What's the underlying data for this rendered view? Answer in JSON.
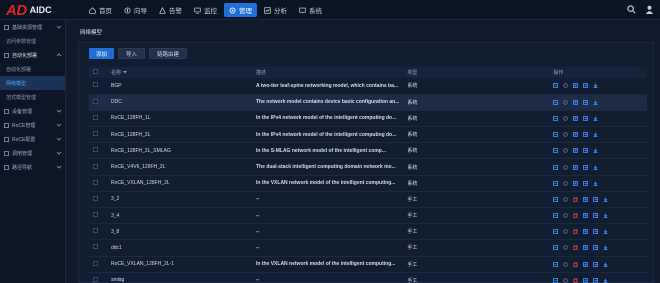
{
  "brand": {
    "mark": "AD",
    "name": "AIDC"
  },
  "nav": [
    {
      "label": "首页",
      "icon": "home-icon"
    },
    {
      "label": "向导",
      "icon": "guide-icon"
    },
    {
      "label": "告警",
      "icon": "alarm-icon"
    },
    {
      "label": "监控",
      "icon": "monitor-icon"
    },
    {
      "label": "管理",
      "icon": "manage-icon",
      "active": true
    },
    {
      "label": "分析",
      "icon": "analysis-icon"
    },
    {
      "label": "系统",
      "icon": "system-icon"
    }
  ],
  "sidebar": {
    "items": [
      {
        "label": "基础资源管理",
        "kind": "group"
      },
      {
        "label": "访问参数管理",
        "kind": "sub"
      },
      {
        "label": "自动化部署",
        "kind": "group-open"
      },
      {
        "label": "自动化部署",
        "kind": "sub"
      },
      {
        "label": "网络模型",
        "kind": "current"
      },
      {
        "label": "范式模型管理",
        "kind": "sub"
      },
      {
        "label": "设备管理",
        "kind": "group"
      },
      {
        "label": "RoCE管理",
        "kind": "group"
      },
      {
        "label": "RoCE配置",
        "kind": "group"
      },
      {
        "label": "调用管理",
        "kind": "group"
      },
      {
        "label": "路径导航",
        "kind": "group"
      }
    ]
  },
  "page": {
    "title": "网络模型"
  },
  "toolbar": {
    "add": "添加",
    "import": "导入",
    "lead": "链路由建"
  },
  "table": {
    "headers": {
      "name": "名称",
      "desc": "描述",
      "type": "类型",
      "ops": "操作"
    },
    "rows": [
      {
        "name": "BGP",
        "desc": "A two-tier leaf-spine networking model, which contains ba...",
        "type": "系统",
        "ops": 5
      },
      {
        "name": "DDC",
        "desc": "The network model contains device basic configuration an...",
        "type": "系统",
        "ops": 5,
        "selected": true
      },
      {
        "name": "RoCE_128FH_1L",
        "desc": "In the IPv4 network model of the intelligent computing do...",
        "type": "系统",
        "ops": 5
      },
      {
        "name": "RoCE_128FH_2L",
        "desc": "In the IPv4 network model of the intelligent computing do...",
        "type": "系统",
        "ops": 5
      },
      {
        "name": "RoCE_128FH_2L_SMLAG",
        "desc": "In the S-MLAG network model of the intelligent comp...",
        "type": "系统",
        "ops": 5
      },
      {
        "name": "RoCE_V4V6_128FH_2L",
        "desc": "The dual-stack intelligent computing domain network mo...",
        "type": "系统",
        "ops": 5
      },
      {
        "name": "RoCE_VXLAN_128FH_2L",
        "desc": "In the VXLAN network model of the intelligent computing...",
        "type": "系统",
        "ops": 5
      },
      {
        "name": "3_2",
        "desc": "--",
        "type": "手工",
        "ops": 6
      },
      {
        "name": "3_4",
        "desc": "--",
        "type": "手工",
        "ops": 6
      },
      {
        "name": "3_8",
        "desc": "--",
        "type": "手工",
        "ops": 6
      },
      {
        "name": "ddc1",
        "desc": "--",
        "type": "手工",
        "ops": 6
      },
      {
        "name": "RoCE_VXLAN_128FH_2L-1",
        "desc": "In the VXLAN network model of the intelligent computing...",
        "type": "手工",
        "ops": 6
      },
      {
        "name": "smlag",
        "desc": "--",
        "type": "手工",
        "ops": 6
      }
    ]
  },
  "colors": {
    "accent": "#1f6fd6",
    "danger": "#e02424",
    "bg": "#0f1a2c"
  }
}
